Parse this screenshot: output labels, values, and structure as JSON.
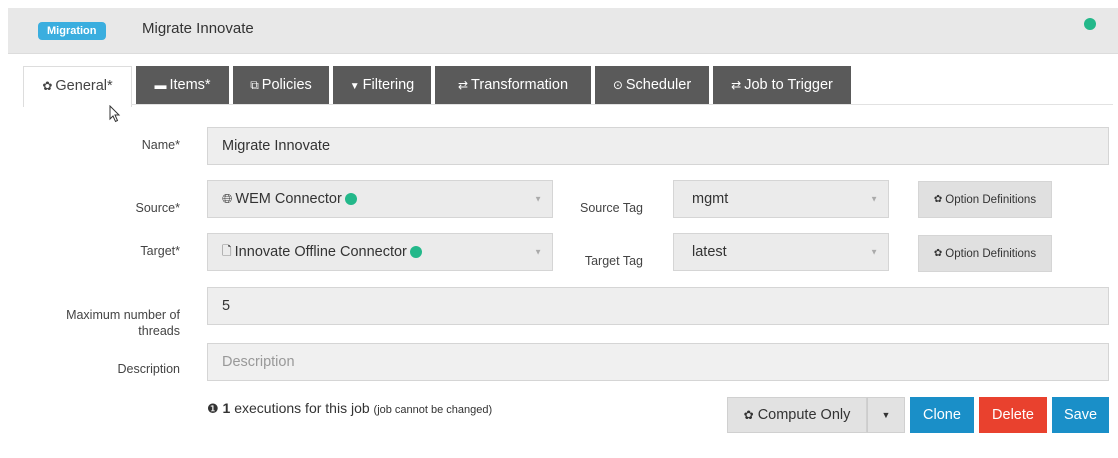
{
  "header": {
    "badge": "Migration",
    "title": "Migrate Innovate",
    "status_color": "#23b88a"
  },
  "tabs": [
    {
      "label": "General*",
      "icon": "gear-icon",
      "glyph": "✿"
    },
    {
      "label": "Items*",
      "icon": "items-icon",
      "glyph": "▬"
    },
    {
      "label": "Policies",
      "icon": "copy-icon",
      "glyph": "⧉"
    },
    {
      "label": "Filtering",
      "icon": "filter-icon",
      "glyph": "▼"
    },
    {
      "label": "Transformation",
      "icon": "exchange-icon",
      "glyph": "⇄"
    },
    {
      "label": "Scheduler",
      "icon": "clock-icon",
      "glyph": "⊙"
    },
    {
      "label": "Job to Trigger",
      "icon": "exchange-icon",
      "glyph": "⇄"
    }
  ],
  "form": {
    "name_label": "Name*",
    "name_value": "Migrate Innovate",
    "source_label": "Source*",
    "source_value": "WEM Connector",
    "source_icon": "globe-icon",
    "source_tag_label": "Source Tag",
    "source_tag_value": "mgmt",
    "target_label": "Target*",
    "target_value": "Innovate Offline Connector",
    "target_icon": "file-icon",
    "target_tag_label": "Target Tag",
    "target_tag_value": "latest",
    "option_definitions": "Option Definitions",
    "threads_label_1": "Maximum number of",
    "threads_label_2": "threads",
    "threads_value": "5",
    "description_label": "Description",
    "description_placeholder": "Description"
  },
  "footer": {
    "count": "1",
    "info_text": " executions for this job ",
    "info_note": "(job cannot be changed)",
    "compute_label": "Compute Only",
    "clone_label": "Clone",
    "delete_label": "Delete",
    "save_label": "Save"
  },
  "colors": {
    "accent": "#1a8fc8",
    "danger": "#e9412e",
    "badge": "#3aaedf",
    "tab_dark": "#5a5a5a"
  }
}
